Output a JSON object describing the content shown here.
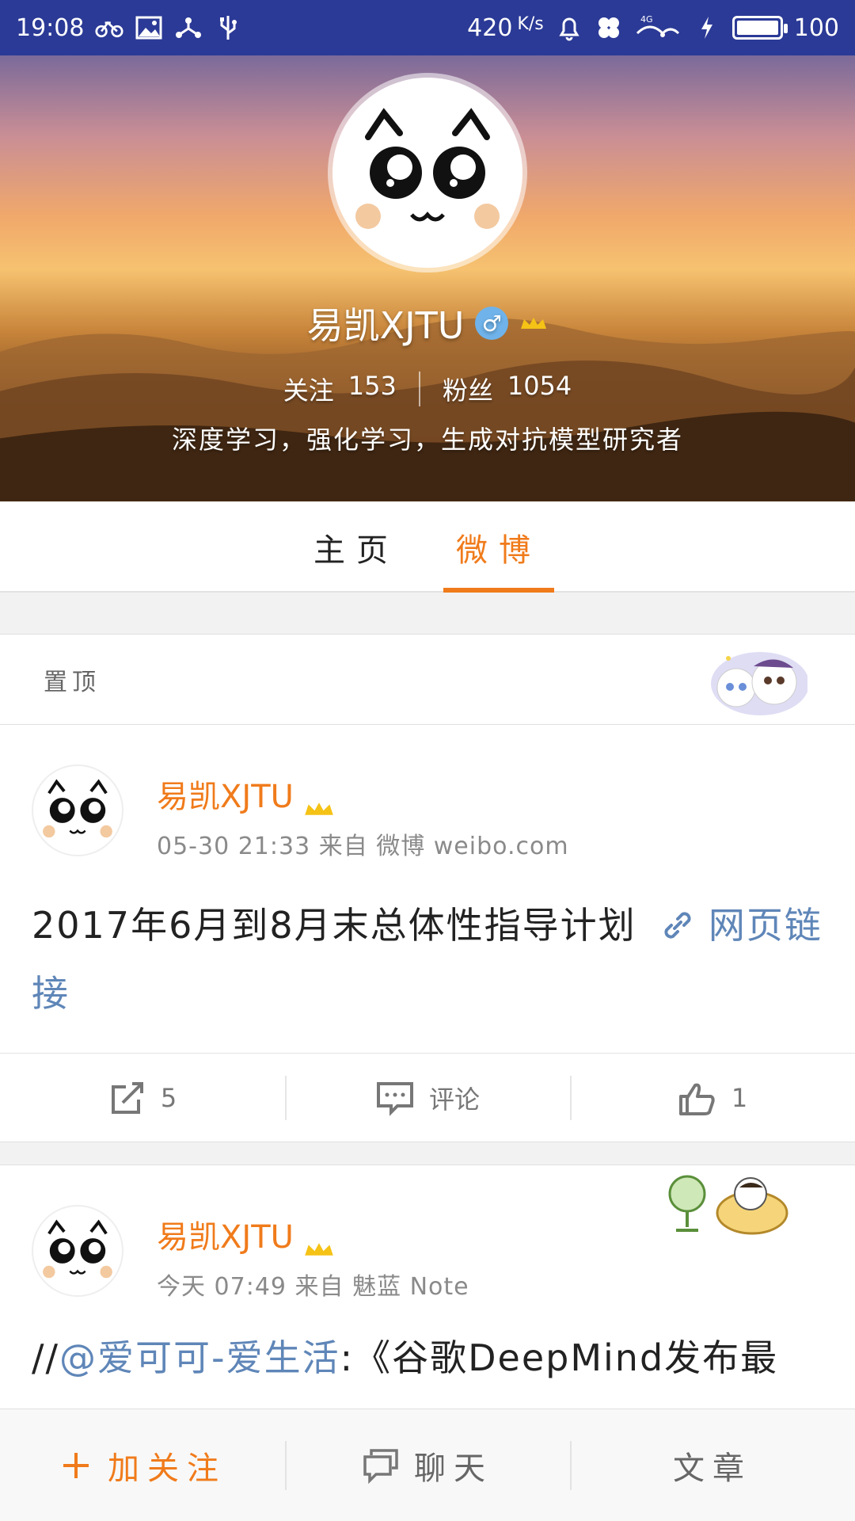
{
  "status_bar": {
    "time": "19:08",
    "network_speed": "420",
    "speed_unit": "K/s",
    "network_type": "4G",
    "battery": "100",
    "battery_level": 1.0
  },
  "profile": {
    "name": "易凯XJTU",
    "gender_symbol": "♂",
    "following_label": "关注",
    "following_count": "153",
    "followers_label": "粉丝",
    "followers_count": "1054",
    "bio": "深度学习，强化学习，生成对抗模型研究者"
  },
  "tabs": [
    {
      "label": "主页",
      "active": false
    },
    {
      "label": "微博",
      "active": true
    }
  ],
  "pinned": {
    "label": "置顶"
  },
  "posts": [
    {
      "username": "易凯XJTU",
      "meta": "05-30 21:33 来自 微博 weibo.com",
      "text": "2017年6月到8月末总体性指导计划",
      "link_text": "网页链接",
      "repost_count": "5",
      "comment_label": "评论",
      "like_count": "1"
    },
    {
      "username": "易凯XJTU",
      "meta": "今天 07:49 来自 魅蓝 Note",
      "text_prefix": "//",
      "mention": "@爱可可-爱生活",
      "text": ":《谷歌DeepMind发布最"
    }
  ],
  "bottom_bar": {
    "follow_label": "加关注",
    "chat_label": "聊天",
    "article_label": "文章"
  },
  "colors": {
    "accent": "#f07b1b",
    "link": "#5f86b8",
    "status_bar": "#2b3a96"
  }
}
